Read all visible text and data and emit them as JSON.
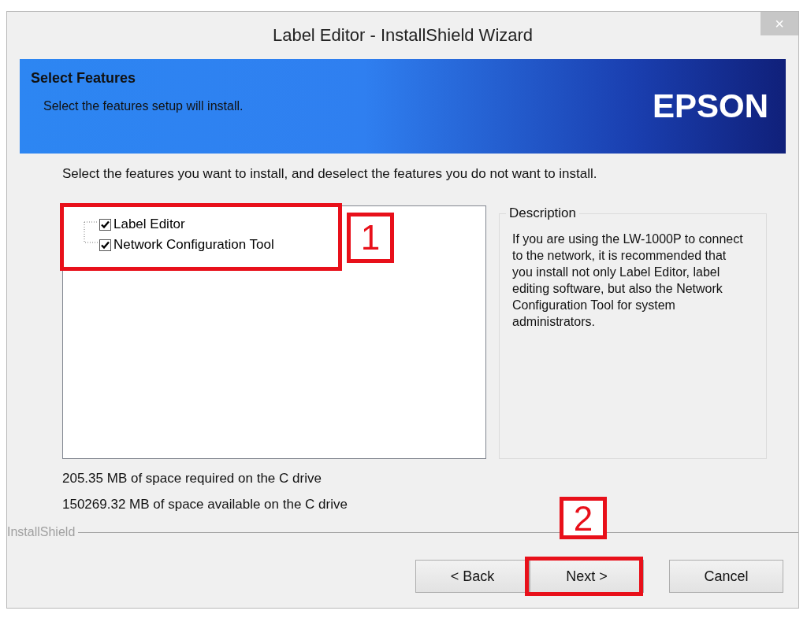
{
  "window": {
    "title": "Label Editor - InstallShield Wizard",
    "close": "×"
  },
  "banner": {
    "title": "Select Features",
    "subtitle": "Select the features setup will install.",
    "logo": "EPSON"
  },
  "instruction": "Select the features you want to install, and deselect the features you do not want to install.",
  "tree": {
    "highlighted": true,
    "callout": "1",
    "items": [
      {
        "label": "Label Editor",
        "checked": true
      },
      {
        "label": "Network Configuration Tool",
        "checked": true
      }
    ]
  },
  "description": {
    "title": "Description",
    "text": "If you are using the LW-1000P to connect to the network, it is recommended that you install not only Label Editor, label editing software, but also the Network Configuration Tool for system administrators."
  },
  "space": [
    "205.35 MB of space required on the C drive",
    "150269.32 MB of space available on the C drive"
  ],
  "brand": "InstallShield",
  "buttons": [
    {
      "label": "< Back",
      "highlighted": false
    },
    {
      "label": "Next >",
      "highlighted": true,
      "callout": "2"
    },
    {
      "label": "Cancel",
      "highlighted": false
    }
  ]
}
